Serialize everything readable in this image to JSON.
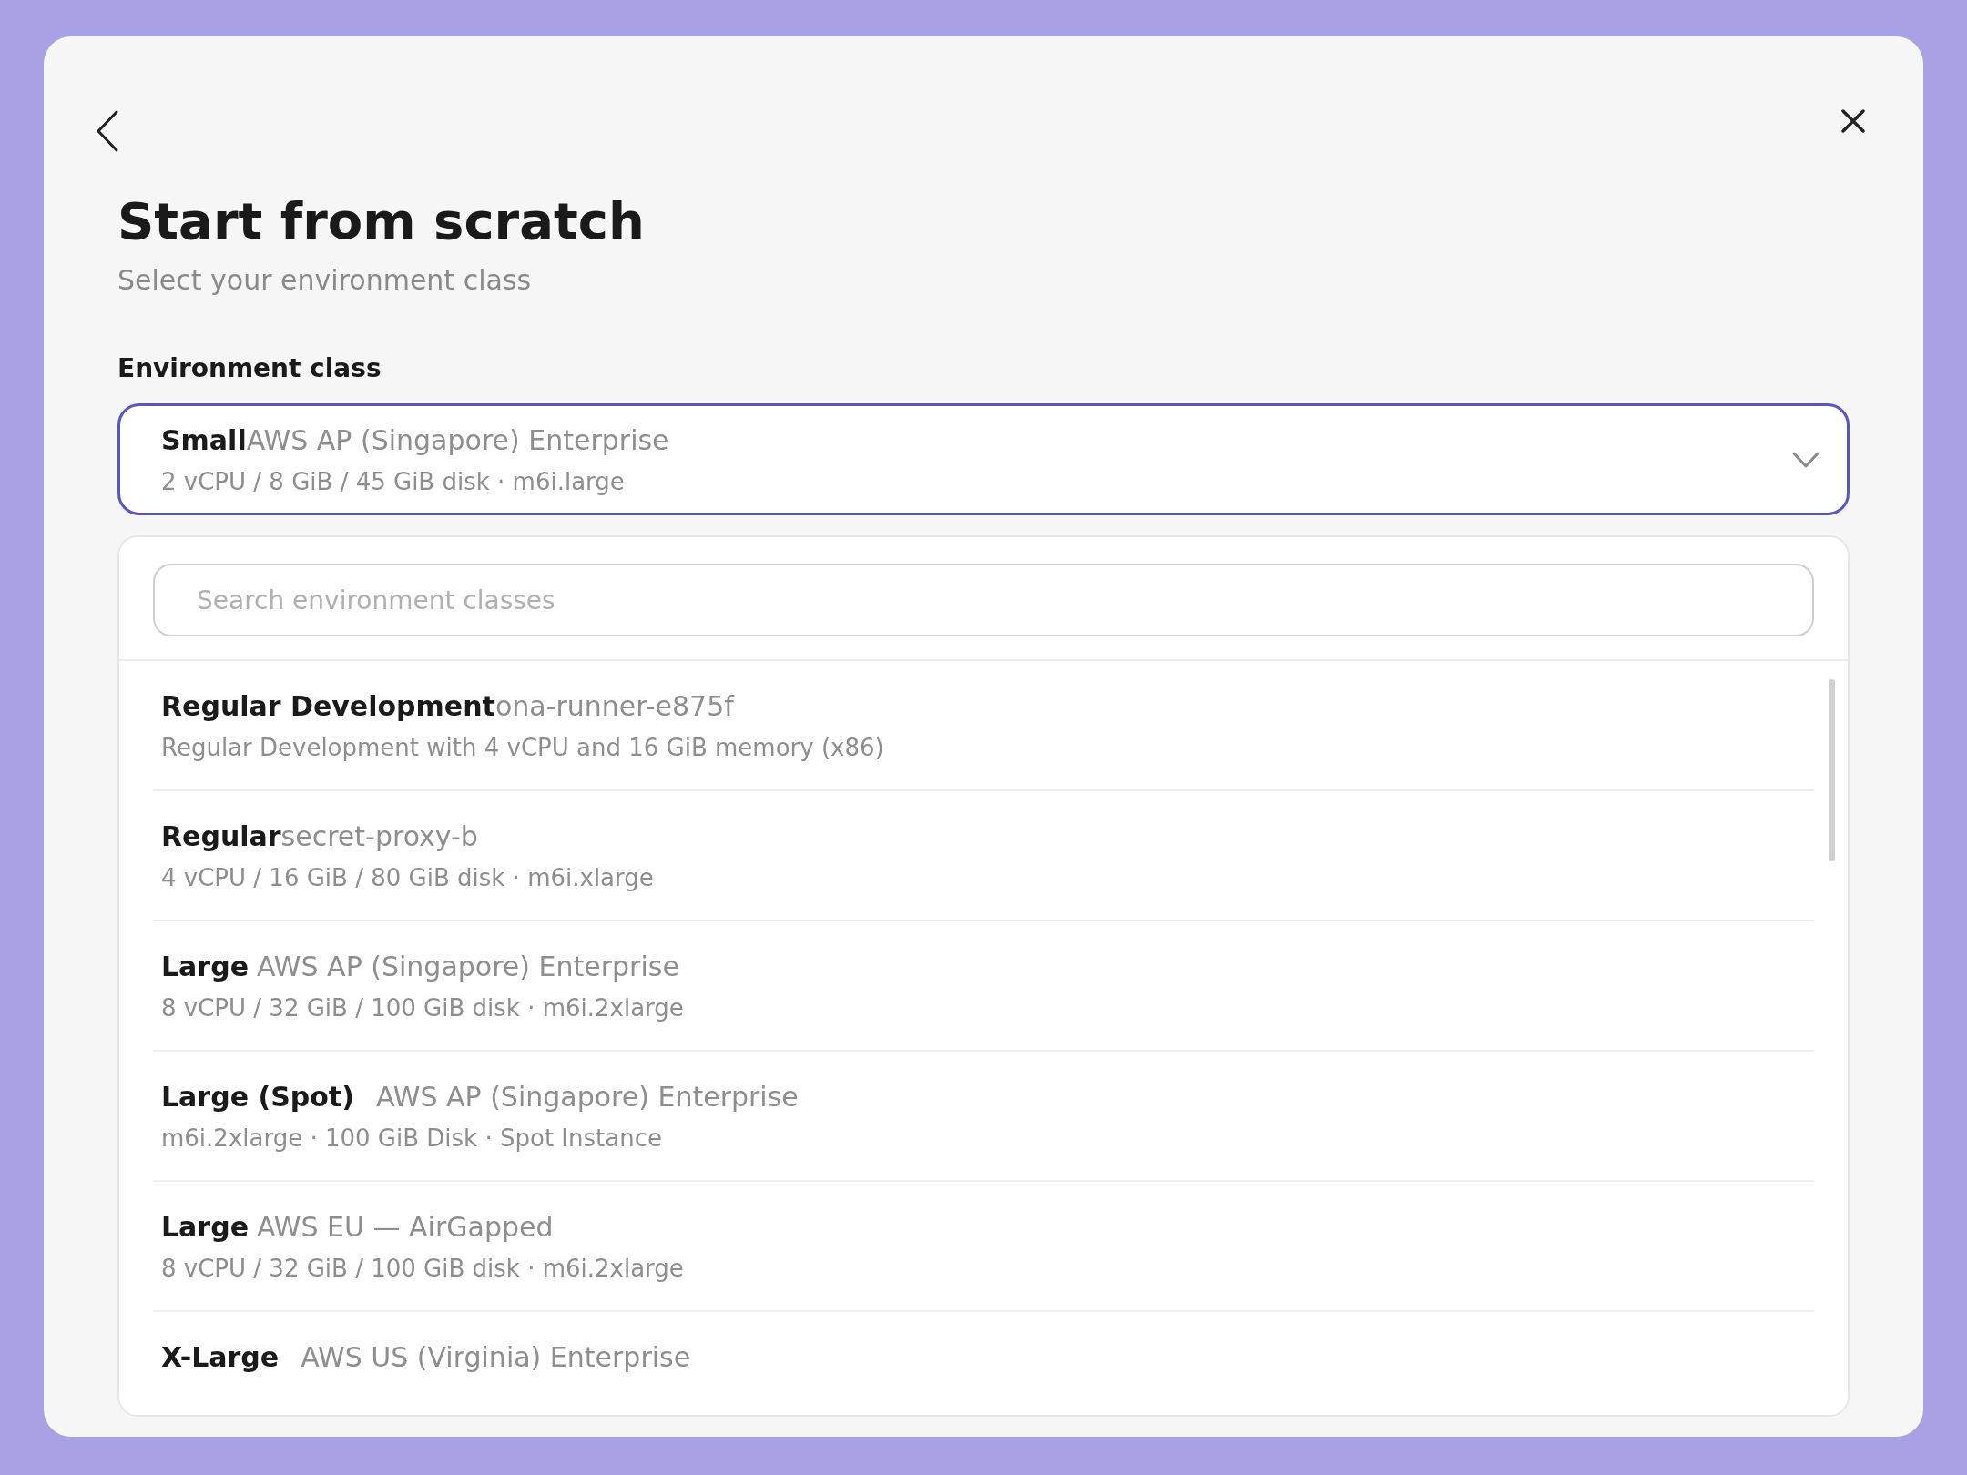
{
  "dialog": {
    "title": "Start from scratch",
    "subtitle": "Select your environment class"
  },
  "field": {
    "label": "Environment class",
    "selected": {
      "name": "Small",
      "region": "AWS AP (Singapore) Enterprise",
      "details": "2 vCPU / 8 GiB / 45 GiB disk · m6i.large"
    },
    "expanded": true
  },
  "search": {
    "placeholder": "Search environment classes"
  },
  "options": [
    {
      "name": "Regular Development",
      "region": "ona-runner-e875f",
      "kind": "joined",
      "details": "Regular Development with 4 vCPU and 16 GiB memory (x86)"
    },
    {
      "name": "Regular",
      "region": "secret-proxy-b",
      "kind": "joined",
      "details": "4 vCPU / 16 GiB / 80 GiB disk · m6i.xlarge"
    },
    {
      "name": "Large",
      "region": "AWS AP (Singapore) Enterprise",
      "kind": "spaced",
      "details": "8 vCPU / 32 GiB / 100 GiB disk · m6i.2xlarge"
    },
    {
      "name": "Large (Spot)",
      "region": "AWS AP (Singapore) Enterprise",
      "kind": "wide",
      "details": "m6i.2xlarge · 100 GiB Disk · Spot Instance"
    },
    {
      "name": "Large",
      "region": "AWS EU — AirGapped",
      "kind": "spaced",
      "details": "8 vCPU / 32 GiB / 100 GiB disk · m6i.2xlarge"
    },
    {
      "name": "X-Large",
      "region": "AWS US (Virginia) Enterprise",
      "kind": "wide"
    }
  ]
}
